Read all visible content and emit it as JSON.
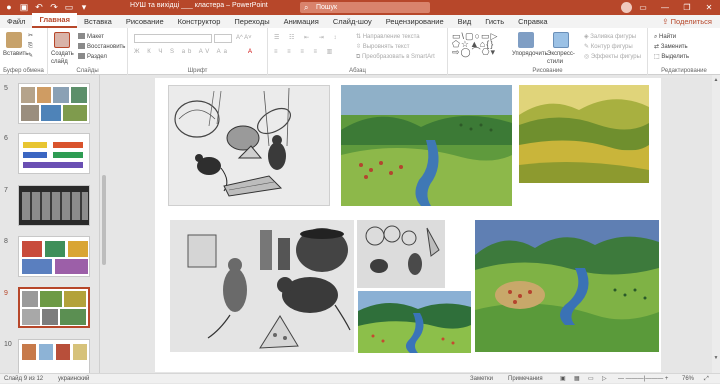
{
  "titlebar": {
    "doc_title": "НУШ та вихідці ___ кластера – PowerPoint",
    "search_placeholder": "Пошук",
    "minimize": "—",
    "restore": "❐",
    "close": "✕"
  },
  "tabs": [
    "Файл",
    "Главная",
    "Вставка",
    "Рисование",
    "Конструктор",
    "Переходы",
    "Анимация",
    "Слайд-шоу",
    "Рецензирование",
    "Вид",
    "Гисть",
    "Справка"
  ],
  "active_tab": "Главная",
  "share_label": "Поделиться",
  "ribbon": {
    "groups": [
      {
        "id": "clipboard",
        "label": "Буфер обмена",
        "buttons": [
          "Вставить"
        ]
      },
      {
        "id": "slides",
        "label": "Слайды",
        "buttons": [
          "Создать слайд",
          "Макет",
          "Восстановить",
          "Раздел"
        ]
      },
      {
        "id": "font",
        "label": "Шрифт",
        "buttons": []
      },
      {
        "id": "paragraph",
        "label": "Абзац",
        "buttons": [
          "Направление текста",
          "Выровнять текст",
          "Преобразовать в SmartArt"
        ]
      },
      {
        "id": "drawing",
        "label": "Рисование",
        "buttons": [
          "Упорядочить",
          "Экспресс-стили",
          "Заливка фигуры",
          "Контур фигуры",
          "Эффекты фигуры"
        ]
      },
      {
        "id": "editing",
        "label": "Редактирование",
        "buttons": [
          "Найти",
          "Заменить",
          "Выделить"
        ]
      }
    ]
  },
  "sidebar": {
    "slides": [
      {
        "number": "5"
      },
      {
        "number": "6"
      },
      {
        "number": "7"
      },
      {
        "number": "8"
      },
      {
        "number": "9"
      },
      {
        "number": "10"
      }
    ],
    "selected": "9"
  },
  "statusbar": {
    "slide_info": "Слайд 9 из 12",
    "language": "украинский",
    "notes": "Заметки",
    "comments": "Примечания",
    "zoom": "76%"
  },
  "colors": {
    "accent": "#b7472a"
  }
}
